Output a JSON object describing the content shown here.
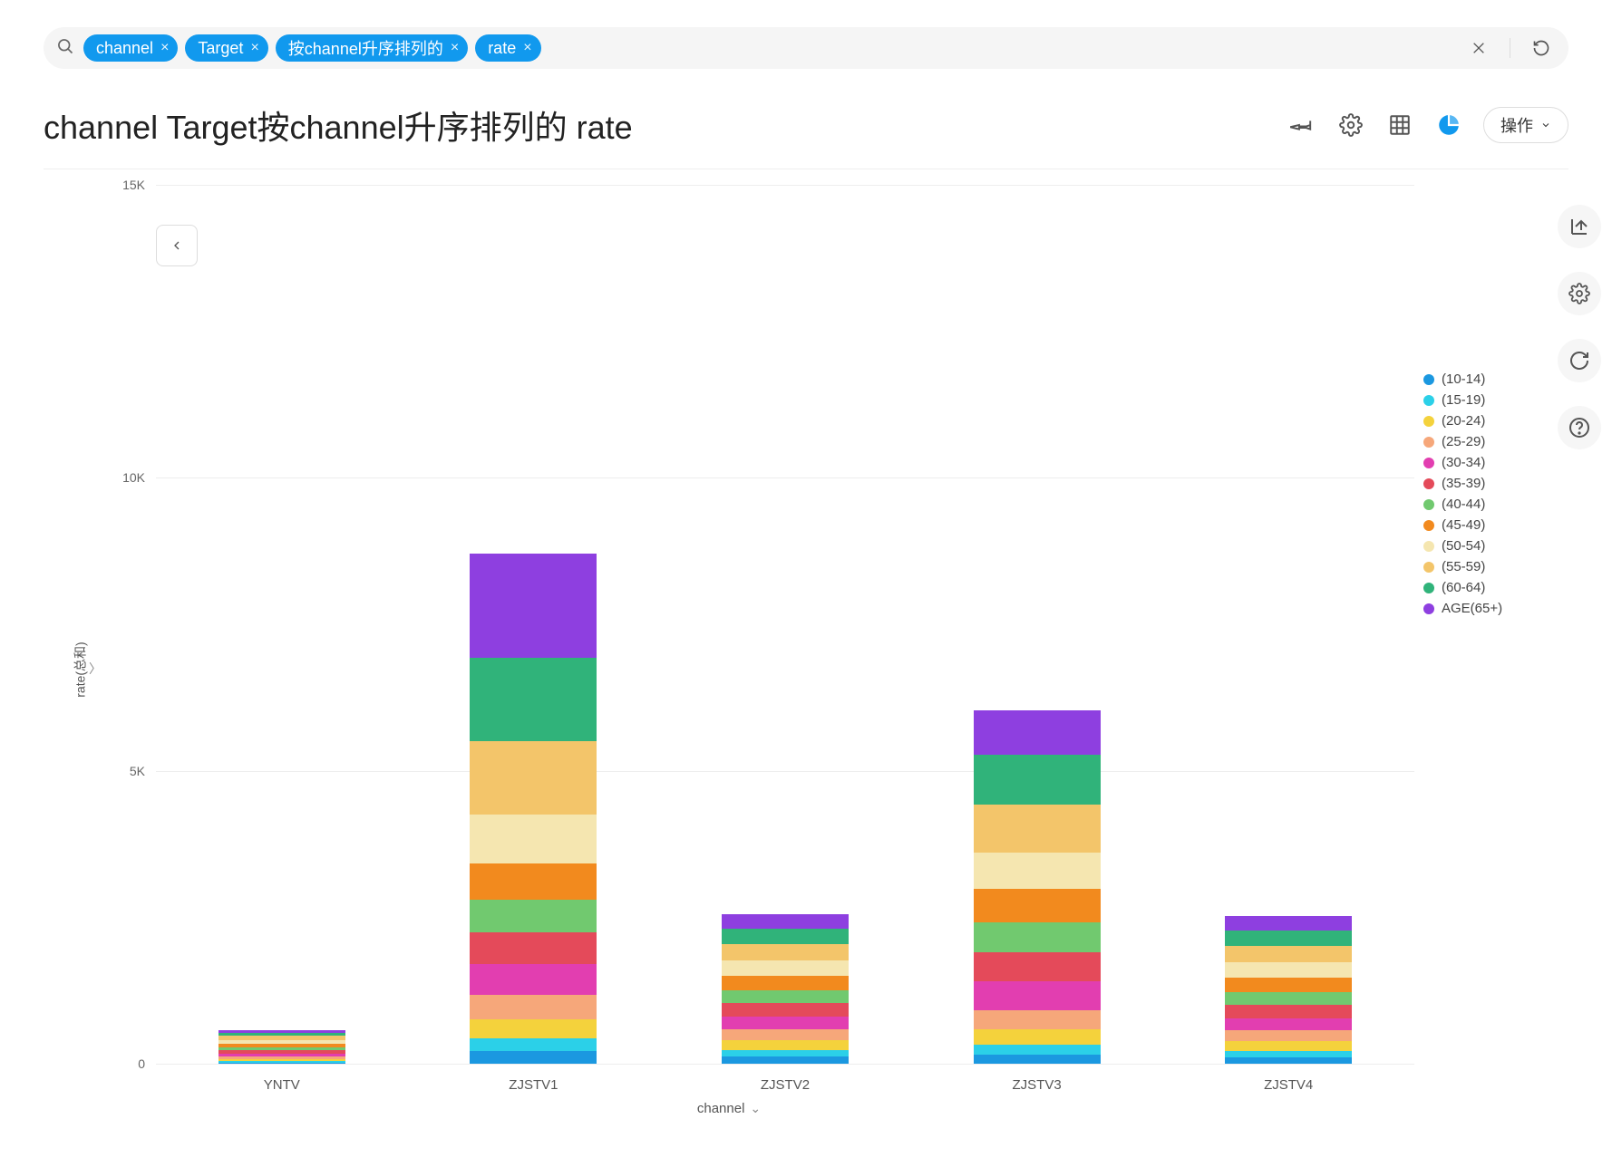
{
  "search": {
    "chips": [
      "channel",
      "Target",
      "按channel升序排列的",
      "rate"
    ]
  },
  "header": {
    "title": "channel Target按channel升序排列的 rate",
    "action_label": "操作"
  },
  "chart_data": {
    "type": "bar",
    "stacked": true,
    "xlabel": "channel",
    "ylabel": "rate(总和)",
    "ylim": [
      0,
      15000
    ],
    "yticks": [
      0,
      5000,
      10000,
      15000
    ],
    "ytick_labels": [
      "0",
      "5K",
      "10K",
      "15K"
    ],
    "categories": [
      "YNTV",
      "ZJSTV1",
      "ZJSTV2",
      "ZJSTV3",
      "ZJSTV4"
    ],
    "series": [
      {
        "name": "(10-14)",
        "color": "#1b98e0",
        "values": [
          20,
          220,
          120,
          160,
          110
        ]
      },
      {
        "name": "(15-19)",
        "color": "#2bd0e8",
        "values": [
          20,
          220,
          120,
          170,
          110
        ]
      },
      {
        "name": "(20-24)",
        "color": "#f4d23c",
        "values": [
          35,
          320,
          160,
          260,
          160
        ]
      },
      {
        "name": "(25-29)",
        "color": "#f6a77a",
        "values": [
          45,
          420,
          190,
          330,
          190
        ]
      },
      {
        "name": "(30-34)",
        "color": "#e23eb0",
        "values": [
          55,
          520,
          220,
          490,
          210
        ]
      },
      {
        "name": "(35-39)",
        "color": "#e44a5a",
        "values": [
          55,
          540,
          220,
          490,
          220
        ]
      },
      {
        "name": "(40-44)",
        "color": "#71c96f",
        "values": [
          55,
          560,
          230,
          510,
          230
        ]
      },
      {
        "name": "(45-49)",
        "color": "#f28a1e",
        "values": [
          60,
          620,
          240,
          570,
          240
        ]
      },
      {
        "name": "(50-54)",
        "color": "#f5e6b0",
        "values": [
          60,
          830,
          260,
          620,
          260
        ]
      },
      {
        "name": "(55-59)",
        "color": "#f3c56a",
        "values": [
          70,
          1250,
          280,
          830,
          280
        ]
      },
      {
        "name": "(60-64)",
        "color": "#30b37a",
        "values": [
          55,
          1430,
          260,
          850,
          260
        ]
      },
      {
        "name": "AGE(65+)",
        "color": "#8e3fe0",
        "values": [
          50,
          1770,
          250,
          760,
          250
        ]
      }
    ]
  }
}
